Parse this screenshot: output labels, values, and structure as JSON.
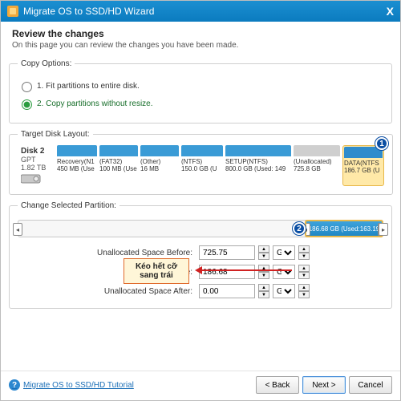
{
  "titlebar": {
    "title": "Migrate OS to SSD/HD Wizard",
    "close": "X"
  },
  "header": {
    "h": "Review the changes",
    "sub": "On this page you can review the changes you have been made."
  },
  "copy_options": {
    "legend": "Copy Options:",
    "opt1": "1. Fit partitions to entire disk.",
    "opt2": "2. Copy partitions without resize."
  },
  "target_layout": {
    "legend": "Target Disk Layout:",
    "disk": {
      "name": "Disk 2",
      "scheme": "GPT",
      "size": "1.82 TB"
    },
    "parts": [
      {
        "l1": "Recovery(N1",
        "l2": "450 MB (Use"
      },
      {
        "l1": "(FAT32)",
        "l2": "100 MB (Use"
      },
      {
        "l1": "(Other)",
        "l2": "16 MB"
      },
      {
        "l1": "(NTFS)",
        "l2": "150.0 GB (U"
      },
      {
        "l1": "SETUP(NTFS)",
        "l2": "800.0 GB (Used: 149"
      },
      {
        "l1": "(Unallocated)",
        "l2": "725.8 GB"
      },
      {
        "l1": "DATA(NTFS",
        "l2": "186.7 GB (U"
      }
    ],
    "callout1": "1"
  },
  "change_sel": {
    "legend": "Change Selected Partition:",
    "seg_label": "186.68 GB (Used:163.19",
    "callout2": "2",
    "hint": "Kéo hết cỡ sang trái",
    "fields": {
      "before_lbl": "Unallocated Space Before:",
      "before_val": "725.75",
      "size_lbl": "Partition Size:",
      "size_val": "186.68",
      "after_lbl": "Unallocated Space After:",
      "after_val": "0.00",
      "unit": "GB"
    }
  },
  "footer": {
    "tutorial": "Migrate OS to SSD/HD Tutorial",
    "back": "< Back",
    "next": "Next >",
    "cancel": "Cancel"
  }
}
